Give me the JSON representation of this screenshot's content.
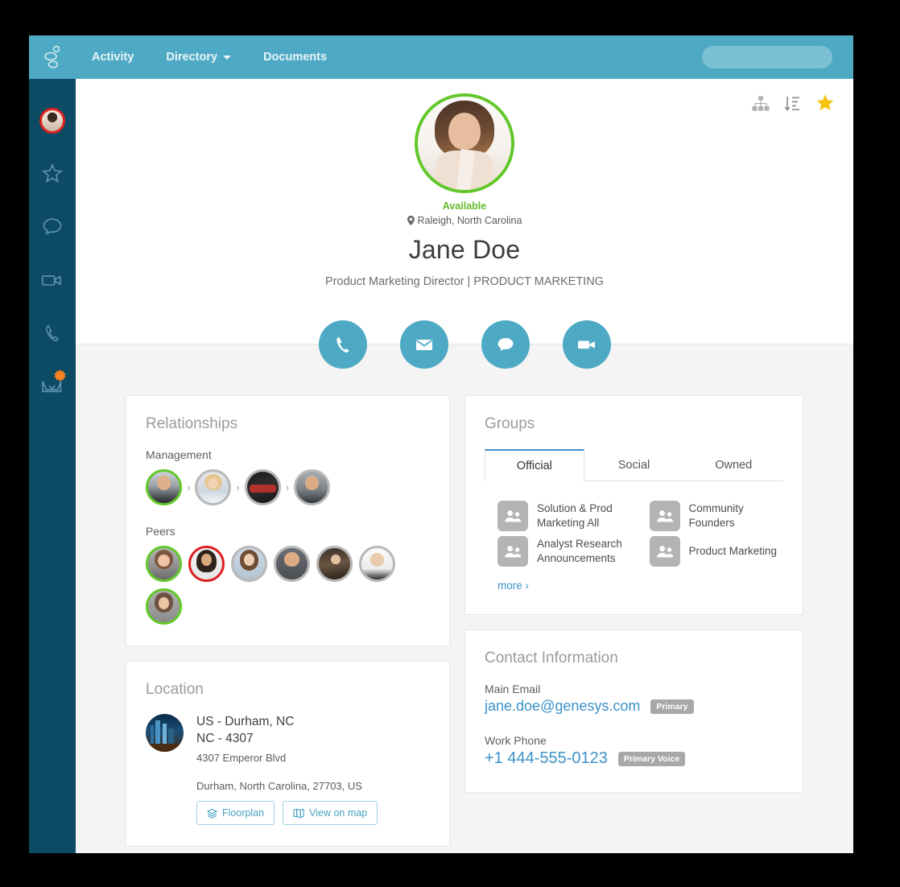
{
  "colors": {
    "header_teal": "#4eaac4",
    "rail_navy": "#0d4a63",
    "available_green": "#62c829",
    "busy_red": "#e02020",
    "link_blue": "#3b93c9",
    "star_gold": "#f5c211",
    "badge_orange": "#f5821f"
  },
  "header": {
    "logo_icon": "genesys-logo-icon",
    "nav": [
      {
        "label": "Activity",
        "has_caret": false
      },
      {
        "label": "Directory",
        "has_caret": true
      },
      {
        "label": "Documents",
        "has_caret": false
      }
    ],
    "search": {
      "value": "",
      "placeholder": "",
      "icon": "search-icon"
    }
  },
  "rail": {
    "items": [
      {
        "name": "profile-avatar",
        "icon": "avatar",
        "status_ring": "#e02020",
        "badge": false
      },
      {
        "name": "favorites",
        "icon": "star-outline-icon",
        "badge": false
      },
      {
        "name": "chat",
        "icon": "chat-bubble-icon",
        "badge": false
      },
      {
        "name": "video",
        "icon": "video-camera-icon",
        "badge": false
      },
      {
        "name": "calls",
        "icon": "phone-handset-icon",
        "badge": false
      },
      {
        "name": "inbox",
        "icon": "inbox-tray-icon",
        "badge": true
      }
    ]
  },
  "profile": {
    "hero_icons": [
      {
        "name": "org-chart-icon",
        "label": "org-chart"
      },
      {
        "name": "sort-descending-icon",
        "label": "sort"
      },
      {
        "name": "favorite-star-icon",
        "label": "favorite",
        "active": true
      }
    ],
    "avatar_ring": "#62c829",
    "presence": "Available",
    "location_pin_icon": "map-pin-icon",
    "location": "Raleigh, North Carolina",
    "name": "Jane Doe",
    "title": "Product Marketing Director | PRODUCT MARKETING",
    "actions": [
      {
        "name": "call-button",
        "icon": "phone-handset-icon"
      },
      {
        "name": "email-button",
        "icon": "envelope-icon"
      },
      {
        "name": "chat-button",
        "icon": "chat-bubble-icon"
      },
      {
        "name": "video-button",
        "icon": "video-camera-icon"
      }
    ]
  },
  "relationships": {
    "title": "Relationships",
    "management_label": "Management",
    "management": [
      {
        "ring": "#62c829",
        "tone1": "#6f6256",
        "tone2": "#2b2b2b"
      },
      {
        "ring": "#b9b9b9",
        "tone1": "#d8c18f",
        "tone2": "#cfd6dd"
      },
      {
        "ring": "#b9b9b9",
        "tone1": "#2a2a2a",
        "tone2": "#b42d2d"
      },
      {
        "ring": "#b9b9b9",
        "tone1": "#8c8f93",
        "tone2": "#3a3a3a"
      }
    ],
    "separator": "›",
    "peers_label": "Peers",
    "peers": [
      {
        "ring": "#62c829",
        "tone1": "#7a5a44",
        "tone2": "#9a9a9a"
      },
      {
        "ring": "#e02020",
        "tone1": "#3a2a22",
        "tone2": "#efefef"
      },
      {
        "ring": "#b9b9b9",
        "tone1": "#6b4a33",
        "tone2": "#c9d6e2"
      },
      {
        "ring": "#b9b9b9",
        "tone1": "#55585c",
        "tone2": "#3f4246"
      },
      {
        "ring": "#b9b9b9",
        "tone1": "#4a3b2e",
        "tone2": "#2a2119"
      },
      {
        "ring": "#b9b9b9",
        "tone1": "#e8e8e8",
        "tone2": "#cfcfcf"
      },
      {
        "ring": "#62c829",
        "tone1": "#6a5344",
        "tone2": "#8e8e8e"
      }
    ]
  },
  "groups": {
    "title": "Groups",
    "tabs": [
      {
        "label": "Official",
        "active": true
      },
      {
        "label": "Social",
        "active": false
      },
      {
        "label": "Owned",
        "active": false
      }
    ],
    "items": [
      {
        "name": "Solution & Prod Marketing All",
        "icon": "people-icon"
      },
      {
        "name": "Community Founders",
        "icon": "people-icon"
      },
      {
        "name": "Analyst Research Announcements",
        "icon": "people-icon"
      },
      {
        "name": "Product Marketing",
        "icon": "people-icon"
      }
    ],
    "more_label": "more ›"
  },
  "location_card": {
    "title": "Location",
    "thumb_icon": "city-skyline-thumbnail",
    "line1": "US - Durham, NC",
    "line2": "NC - 4307",
    "street": "4307 Emperor Blvd",
    "full_address": "Durham, North Carolina, 27703, US",
    "buttons": [
      {
        "label": "Floorplan",
        "icon": "layers-icon"
      },
      {
        "label": "View on map",
        "icon": "map-icon"
      }
    ]
  },
  "contact": {
    "title": "Contact Information",
    "fields": [
      {
        "label": "Main Email",
        "value": "jane.doe@genesys.com",
        "pill": "Primary"
      },
      {
        "label": "Work Phone",
        "value": "+1 444-555-0123",
        "pill": "Primary Voice"
      }
    ]
  }
}
